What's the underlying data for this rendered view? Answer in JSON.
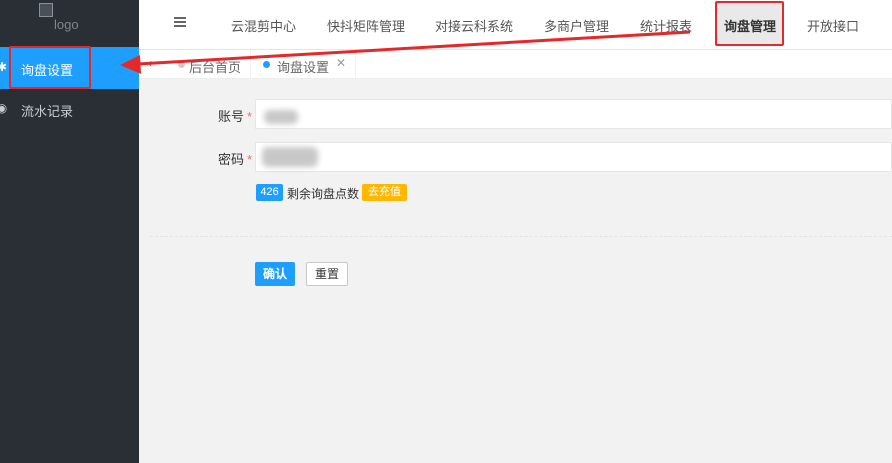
{
  "sidebar": {
    "logo_alt": "logo",
    "items": [
      {
        "label": "询盘设置",
        "icon": "gear-icon",
        "active": true
      },
      {
        "label": "流水记录",
        "icon": "circle-icon",
        "active": false
      }
    ]
  },
  "topnav": {
    "items": [
      "云混剪中心",
      "快抖矩阵管理",
      "对接云科系统",
      "多商户管理",
      "统计报表",
      "询盘管理",
      "开放接口"
    ],
    "active": "询盘管理"
  },
  "tabs": {
    "home": "后台首页",
    "current": "询盘设置"
  },
  "form": {
    "account_label": "账号",
    "password_label": "密码",
    "required_mark": "*",
    "points_count": "426",
    "points_text": "剩余询盘点数",
    "recharge_label": "去充值",
    "confirm_label": "确认",
    "reset_label": "重置"
  },
  "colors": {
    "sidebar_bg": "#2a2f35",
    "accent": "#1e9fff",
    "highlight": "#e5292b",
    "recharge": "#ffb800"
  }
}
